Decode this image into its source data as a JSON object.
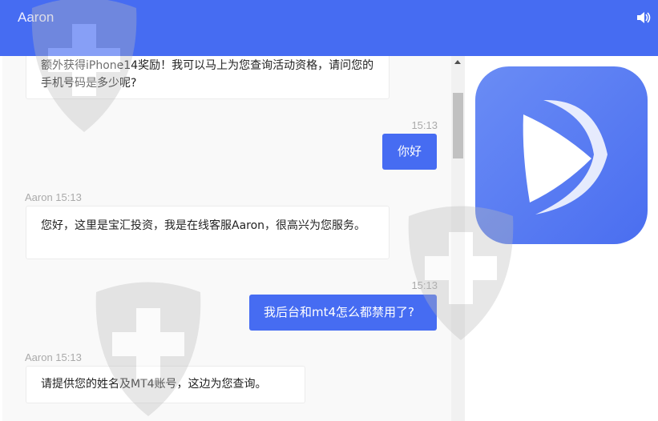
{
  "header": {
    "title": "Aaron",
    "sound_icon": "speaker-icon"
  },
  "messages": [
    {
      "from": "agent",
      "text": "额外获得iPhone14奖励！我可以马上为您查询活动资格，请问您的手机号码是多少呢?"
    },
    {
      "from": "user",
      "time": "15:13",
      "text": "你好"
    },
    {
      "from": "agent",
      "meta": "Aaron 15:13",
      "text": "您好，这里是宝汇投资，我是在线客服Aaron，很高兴为您服务。"
    },
    {
      "from": "user",
      "time": "15:13",
      "text": "我后台和mt4怎么都禁用了?"
    },
    {
      "from": "agent",
      "meta": "Aaron 15:13",
      "text": "请提供您的姓名及MT4账号，这边为您查询。"
    }
  ],
  "colors": {
    "accent": "#466cf2"
  }
}
